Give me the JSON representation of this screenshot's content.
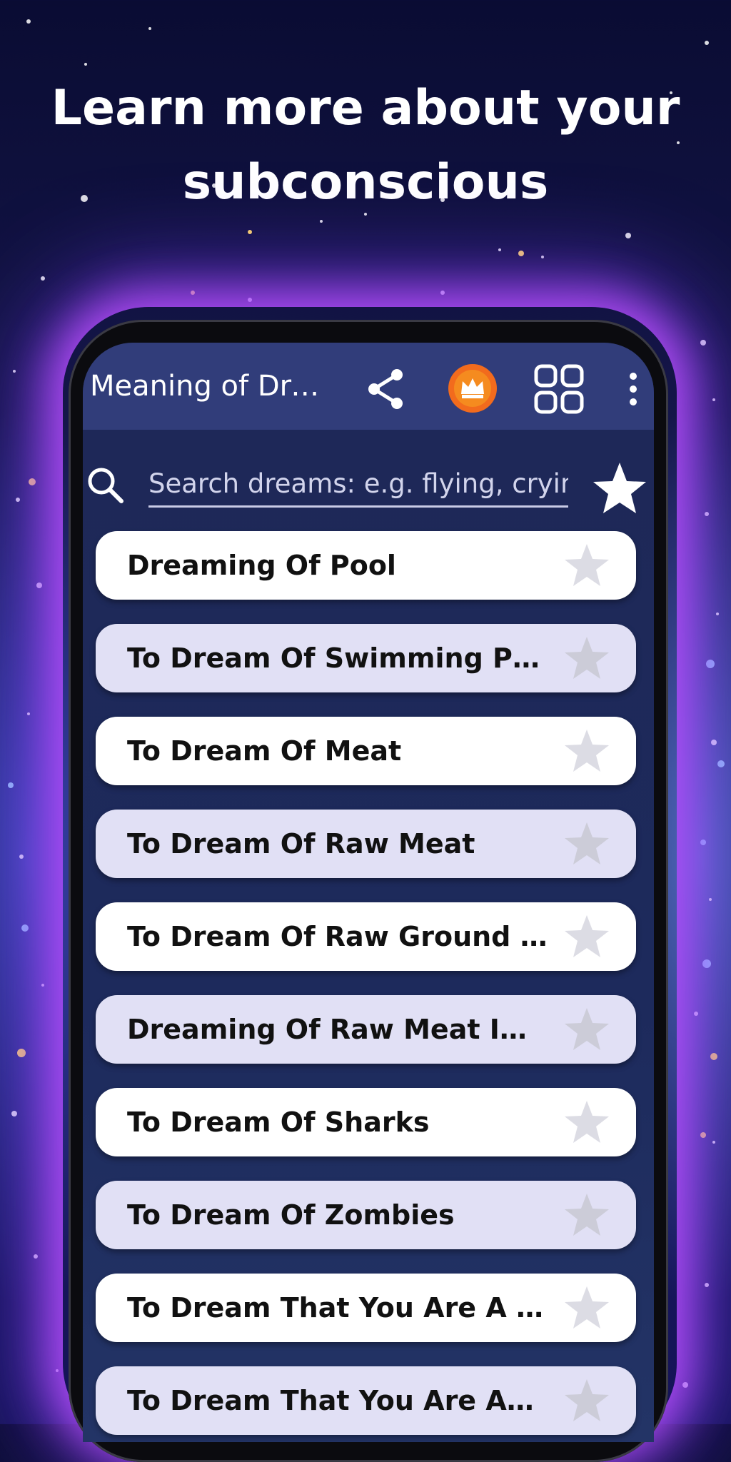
{
  "headline": {
    "line1": "Learn more about your",
    "line2": "subconscious"
  },
  "app": {
    "title": "Meaning of Dreams",
    "icons": [
      "share-icon",
      "crown-icon",
      "grid-icon",
      "more-vert-icon"
    ]
  },
  "search": {
    "placeholder": "Search dreams: e.g. flying, crying, falling",
    "icon": "search-icon",
    "favorites_icon": "star-icon"
  },
  "list": {
    "items": [
      {
        "label": "Dreaming Of Pool"
      },
      {
        "label": "To Dream Of Swimming Pool"
      },
      {
        "label": "To Dream Of Meat"
      },
      {
        "label": "To Dream Of Raw Meat"
      },
      {
        "label": "To Dream Of Raw Ground Meat"
      },
      {
        "label": "Dreaming Of Raw Meat In Abundance"
      },
      {
        "label": "To Dream Of Sharks"
      },
      {
        "label": "To Dream Of Zombies"
      },
      {
        "label": "To Dream That You Are A Zombie"
      },
      {
        "label": "To Dream That You Are Attacked By Zombies"
      }
    ]
  },
  "colors": {
    "app_bar": "#313d7a",
    "screen_bg": "#1e2857",
    "row_white": "#ffffff",
    "row_lavender": "#e1e0f5",
    "crown_orange": "#f26b1d",
    "star_inactive": "#dcdce4"
  }
}
